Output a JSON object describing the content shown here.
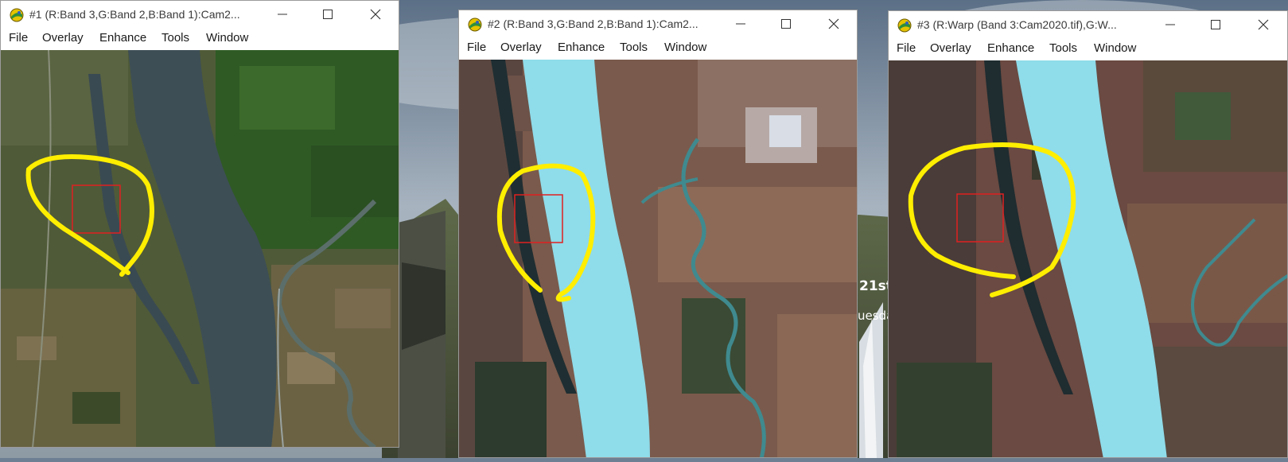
{
  "desktop": {
    "overlay_text_large": "21st",
    "overlay_text_small": "uesday"
  },
  "windows": [
    {
      "title": "#1 (R:Band 3,G:Band 2,B:Band 1):Cam2...",
      "menu": [
        "File",
        "Overlay",
        "Enhance",
        "Tools",
        "Window"
      ],
      "image_style": "natural-color"
    },
    {
      "title": "#2 (R:Band 3,G:Band 2,B:Band 1):Cam2...",
      "menu": [
        "File",
        "Overlay",
        "Enhance",
        "Tools",
        "Window"
      ],
      "image_style": "enhanced-cyan-water"
    },
    {
      "title": "#3 (R:Warp (Band 3:Cam2020.tif),G:W...",
      "menu": [
        "File",
        "Overlay",
        "Enhance",
        "Tools",
        "Window"
      ],
      "image_style": "enhanced-cyan-water"
    }
  ],
  "colors": {
    "annotation": "#ffee00",
    "selection_box": "#e02020",
    "water_natural": "#3d4e55",
    "water_enhanced": "#8fdcea"
  }
}
